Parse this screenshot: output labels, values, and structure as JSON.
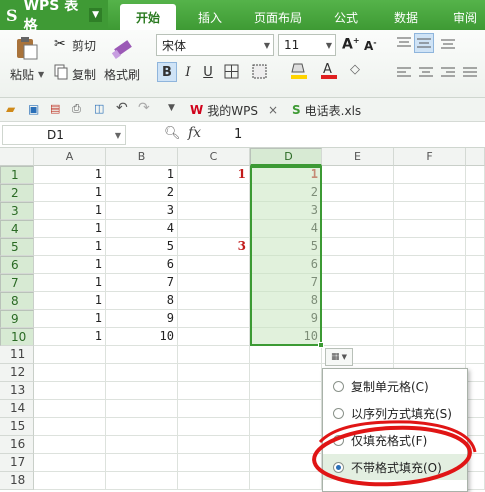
{
  "app": {
    "name": "WPS 表格"
  },
  "tabs": [
    "开始",
    "插入",
    "页面布局",
    "公式",
    "数据",
    "审阅"
  ],
  "ribbon": {
    "paste": "粘贴",
    "cut": "剪切",
    "copy": "复制",
    "format_painter": "格式刷",
    "font_name": "宋体",
    "font_size": "11",
    "bold": "B",
    "italic": "I",
    "underline": "U"
  },
  "doc_tabs": [
    {
      "label": "我的WPS"
    },
    {
      "label": "电话表.xls"
    }
  ],
  "formula_bar": {
    "name_box": "D1",
    "fx": "fx",
    "value": "1"
  },
  "columns": [
    "A",
    "B",
    "C",
    "D",
    "E",
    "F"
  ],
  "rows": [
    "1",
    "2",
    "3",
    "4",
    "5",
    "6",
    "7",
    "8",
    "9",
    "10",
    "11",
    "12",
    "13",
    "14",
    "15",
    "16",
    "17",
    "18"
  ],
  "cells": {
    "A": [
      "1",
      "1",
      "1",
      "1",
      "1",
      "1",
      "1",
      "1",
      "1",
      "1"
    ],
    "B": [
      "1",
      "2",
      "3",
      "4",
      "5",
      "6",
      "7",
      "8",
      "9",
      "10"
    ],
    "D": [
      "1",
      "2",
      "3",
      "4",
      "5",
      "6",
      "7",
      "8",
      "9",
      "10"
    ]
  },
  "annotations": {
    "row1": "1",
    "row5": "3"
  },
  "autofill_menu": {
    "options": [
      "复制单元格(C)",
      "以序列方式填充(S)",
      "仅填充格式(F)",
      "不带格式填充(O)"
    ],
    "selected_index": 3
  },
  "colors": {
    "accent": "#3e9a34",
    "annotation_red": "#c21b1b"
  }
}
